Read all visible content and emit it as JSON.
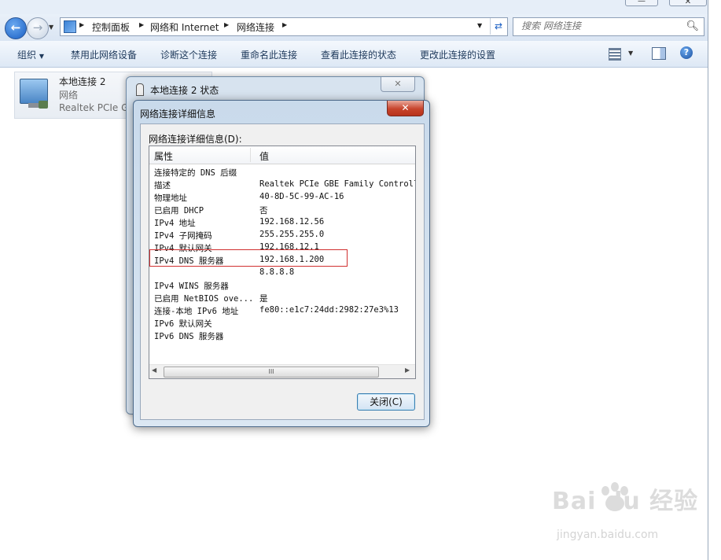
{
  "window": {
    "controls": [
      "—",
      "✕"
    ]
  },
  "nav": {
    "back_icon": "back-arrow-icon",
    "forward_icon": "forward-arrow-icon",
    "breadcrumbs": [
      "控制面板",
      "网络和 Internet",
      "网络连接"
    ],
    "search_placeholder": "搜索 网络连接"
  },
  "toolbar": {
    "organize": "组织",
    "disable": "禁用此网络设备",
    "diagnose": "诊断这个连接",
    "rename": "重命名此连接",
    "view_status": "查看此连接的状态",
    "change_settings": "更改此连接的设置"
  },
  "connection": {
    "name": "本地连接 2",
    "type": "网络",
    "adapter": "Realtek PCIe G"
  },
  "status_window": {
    "title": "本地连接 2 状态",
    "close": "✕"
  },
  "details_dialog": {
    "title": "网络连接详细信息",
    "close": "✕",
    "label": "网络连接详细信息(D):",
    "col_property": "属性",
    "col_value": "值",
    "rows": [
      {
        "property": "连接特定的 DNS 后缀",
        "value": ""
      },
      {
        "property": "描述",
        "value": "Realtek PCIe GBE Family Controlle"
      },
      {
        "property": "物理地址",
        "value": "40-8D-5C-99-AC-16"
      },
      {
        "property": "已启用 DHCP",
        "value": "否"
      },
      {
        "property": "IPv4 地址",
        "value": "192.168.12.56"
      },
      {
        "property": "IPv4 子网掩码",
        "value": "255.255.255.0"
      },
      {
        "property": "IPv4 默认网关",
        "value": "192.168.12.1"
      },
      {
        "property": "IPv4 DNS 服务器",
        "value": "192.168.1.200"
      },
      {
        "property": "",
        "value": "8.8.8.8"
      },
      {
        "property": "IPv4 WINS 服务器",
        "value": ""
      },
      {
        "property": "已启用 NetBIOS ove...",
        "value": "是"
      },
      {
        "property": "连接-本地 IPv6 地址",
        "value": "fe80::e1c7:24dd:2982:27e3%13"
      },
      {
        "property": "IPv6 默认网关",
        "value": ""
      },
      {
        "property": "IPv6 DNS 服务器",
        "value": ""
      }
    ],
    "scroll_thumb": "III",
    "close_button": "关闭(C)"
  },
  "watermark": {
    "logo": "Bai du 经验",
    "url": "jingyan.baidu.com"
  }
}
